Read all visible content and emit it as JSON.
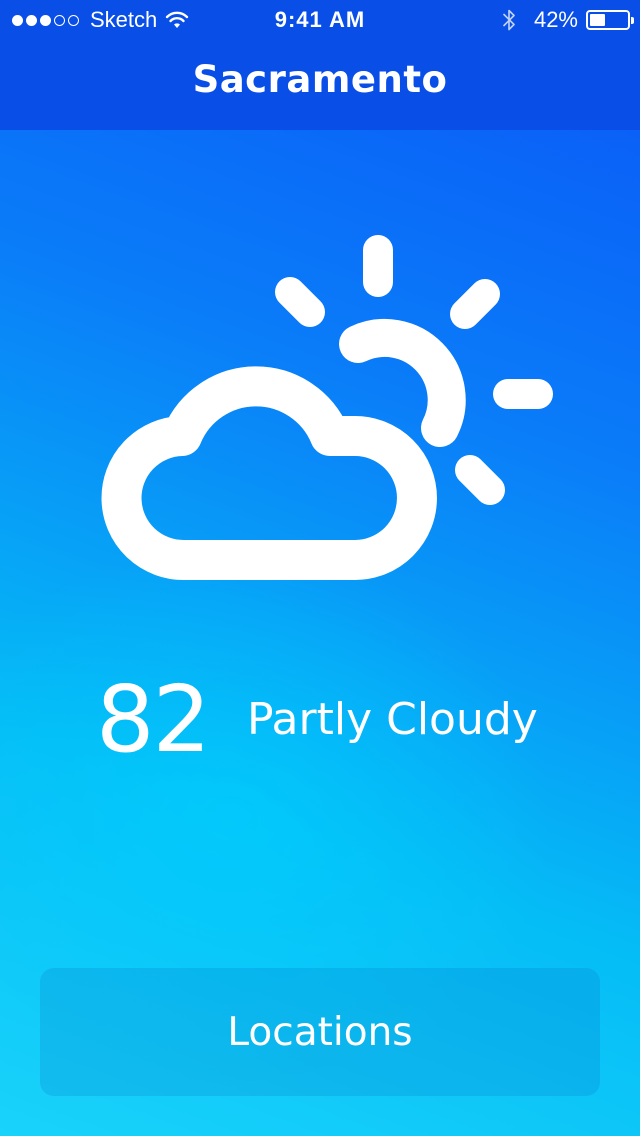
{
  "status_bar": {
    "carrier": "Sketch",
    "signal_bars_filled": 3,
    "signal_bars_total": 5,
    "time": "9:41 AM",
    "battery_percent_label": "42%",
    "battery_level": 0.42,
    "icons": [
      "signal-dots-icon",
      "wifi-icon",
      "bluetooth-icon",
      "battery-icon"
    ]
  },
  "nav": {
    "title": "Sacramento"
  },
  "weather": {
    "icon": "partly-cloudy-icon",
    "temperature": "82",
    "condition": "Partly Cloudy"
  },
  "actions": {
    "locations_label": "Locations"
  },
  "colors": {
    "nav_bar": "#0a4ee8",
    "background_top": "#0b56f7",
    "background_bottom": "#19d3fb",
    "foreground": "#ffffff"
  }
}
